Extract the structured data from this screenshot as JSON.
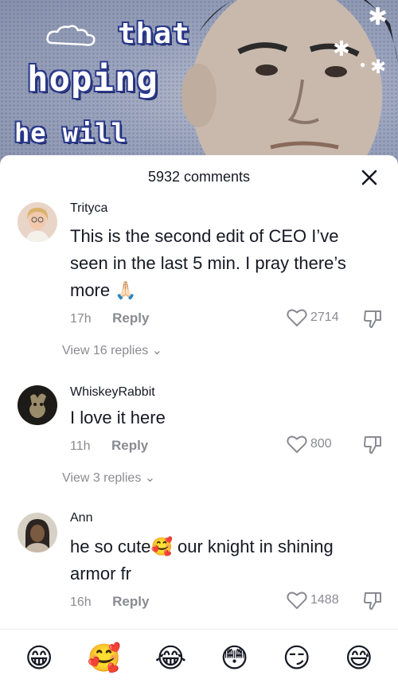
{
  "video": {
    "caption_line1": "that",
    "caption_line2": "hoping",
    "caption_line3": "he will"
  },
  "sheet": {
    "comment_count": "5932 comments"
  },
  "comments": [
    {
      "username": "Trityca",
      "text": "This is the second edit of CEO I’ve seen in the last 5 min. I pray there’s more 🙏🏻",
      "time": "17h",
      "reply_label": "Reply",
      "likes": "2714",
      "view_replies": "View 16 replies"
    },
    {
      "username": "WhiskeyRabbit",
      "text": "I love it here",
      "time": "11h",
      "reply_label": "Reply",
      "likes": "800",
      "view_replies": "View 3 replies"
    },
    {
      "username": "Ann",
      "text": "he so cute🥰 our knight in shining armor fr",
      "time": "16h",
      "reply_label": "Reply",
      "likes": "1488"
    }
  ],
  "emoji_bar": [
    "😁",
    "🥰",
    "😂",
    "😳",
    "😏",
    "😅"
  ],
  "colors": {
    "text_primary": "#161823",
    "text_secondary": "#8a8b91",
    "caption_outline": "#2b3a8c"
  },
  "icons": {
    "close": "close-icon",
    "like": "heart-outline-icon",
    "dislike": "thumbs-down-icon"
  }
}
